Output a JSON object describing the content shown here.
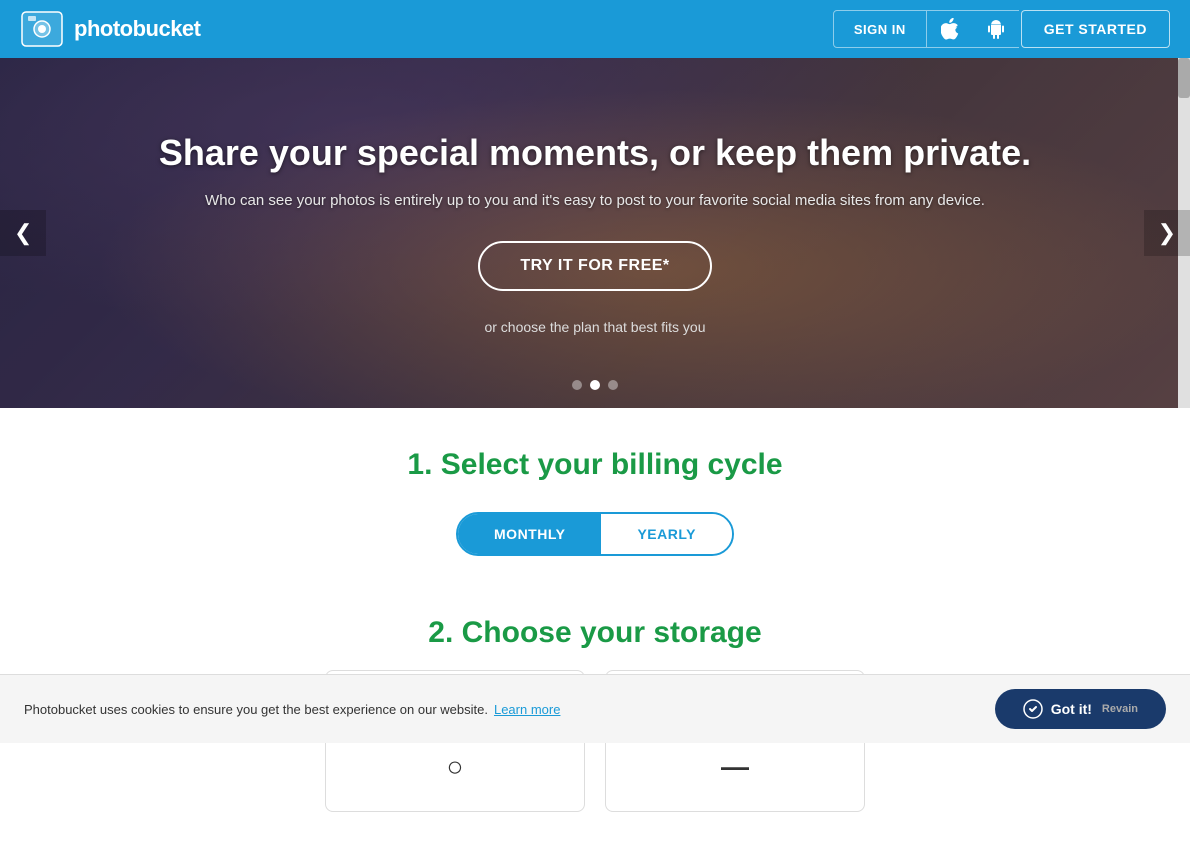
{
  "navbar": {
    "logo_text": "photobucket",
    "signin_label": "SIGN IN",
    "apple_icon": "",
    "android_icon": "🤖",
    "get_started_label": "GET STARTED"
  },
  "hero": {
    "title": "Share your special moments, or keep them private.",
    "subtitle": "Who can see your photos is entirely up to you and it's easy to post to your favorite social media sites from any device.",
    "cta_label": "TRY IT FOR FREE*",
    "choose_plan_text": "or choose the plan that best fits you",
    "dots": [
      {
        "active": false
      },
      {
        "active": true
      },
      {
        "active": false
      }
    ],
    "left_arrow": "❮",
    "right_arrow": "❯"
  },
  "billing_section": {
    "title": "1. Select your billing cycle",
    "monthly_label": "MONTHLY",
    "yearly_label": "YEARLY"
  },
  "storage_section": {
    "title": "2. Choose your storage"
  },
  "cookie": {
    "text": "Photobucket uses cookies to ensure you get the best experience on our website.",
    "learn_more": "Learn more",
    "got_it_label": "Got it!"
  }
}
